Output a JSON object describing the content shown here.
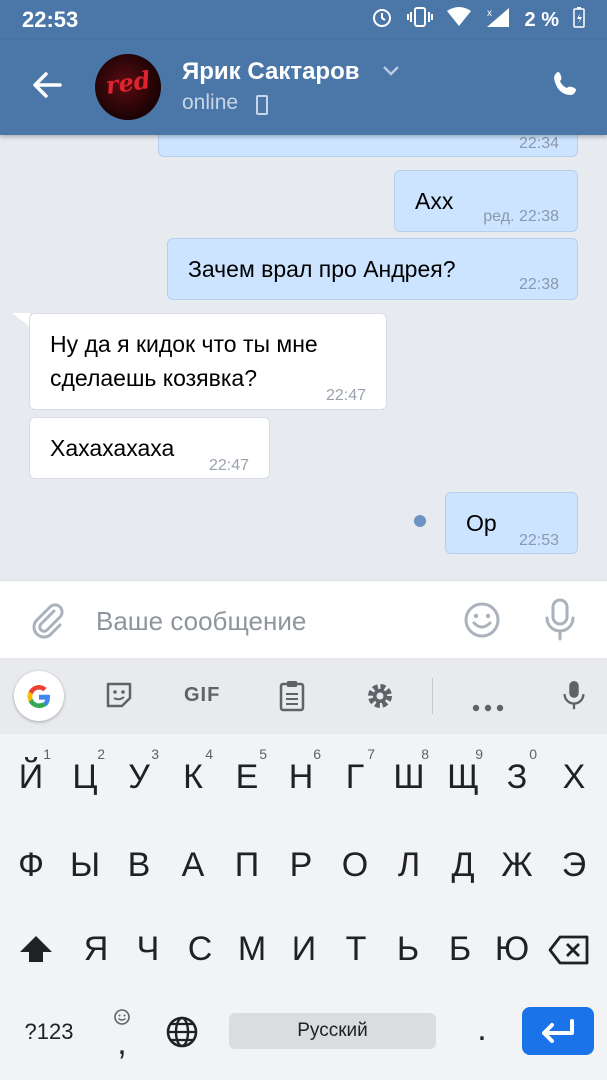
{
  "status_bar": {
    "time": "22:53",
    "battery": "2 %"
  },
  "header": {
    "contact_name": "Ярик Сактаров",
    "contact_status": "online",
    "avatar_text": "red"
  },
  "messages": [
    {
      "direction": "out",
      "text": "",
      "time": "22:34",
      "partial": true
    },
    {
      "direction": "out",
      "text": "Axx",
      "time": "ред. 22:38"
    },
    {
      "direction": "out",
      "text": "Зачем врал про Андрея?",
      "time": "22:38"
    },
    {
      "direction": "in",
      "text_line1": "Ну да я кидок что ты мне",
      "text_line2": "сделаешь козявка?",
      "time": "22:47"
    },
    {
      "direction": "in",
      "text": "Хахахахаха",
      "time": "22:47"
    },
    {
      "direction": "out",
      "text": "Ор",
      "time": "22:53",
      "unread": true
    }
  ],
  "input_bar": {
    "placeholder": "Ваше сообщение"
  },
  "keyboard": {
    "toolbar": {
      "gif_label": "GIF"
    },
    "row1": [
      "Й",
      "Ц",
      "У",
      "К",
      "Е",
      "Н",
      "Г",
      "Ш",
      "Щ",
      "З",
      "Х"
    ],
    "row1_hints": [
      "1",
      "2",
      "3",
      "4",
      "5",
      "6",
      "7",
      "8",
      "9",
      "0",
      ""
    ],
    "row2": [
      "Ф",
      "Ы",
      "В",
      "А",
      "П",
      "Р",
      "О",
      "Л",
      "Д",
      "Ж",
      "Э"
    ],
    "row3": [
      "Я",
      "Ч",
      "С",
      "М",
      "И",
      "Т",
      "Ь",
      "Б",
      "Ю"
    ],
    "symbols_label": "?123",
    "comma": ",",
    "space_label": "Русский",
    "period": "."
  },
  "colors": {
    "header_bg": "#4a76a8",
    "outgoing_bubble": "#cce4ff",
    "incoming_bubble": "#ffffff",
    "chat_bg": "#e7ebf0",
    "enter_key": "#1a73e8"
  }
}
